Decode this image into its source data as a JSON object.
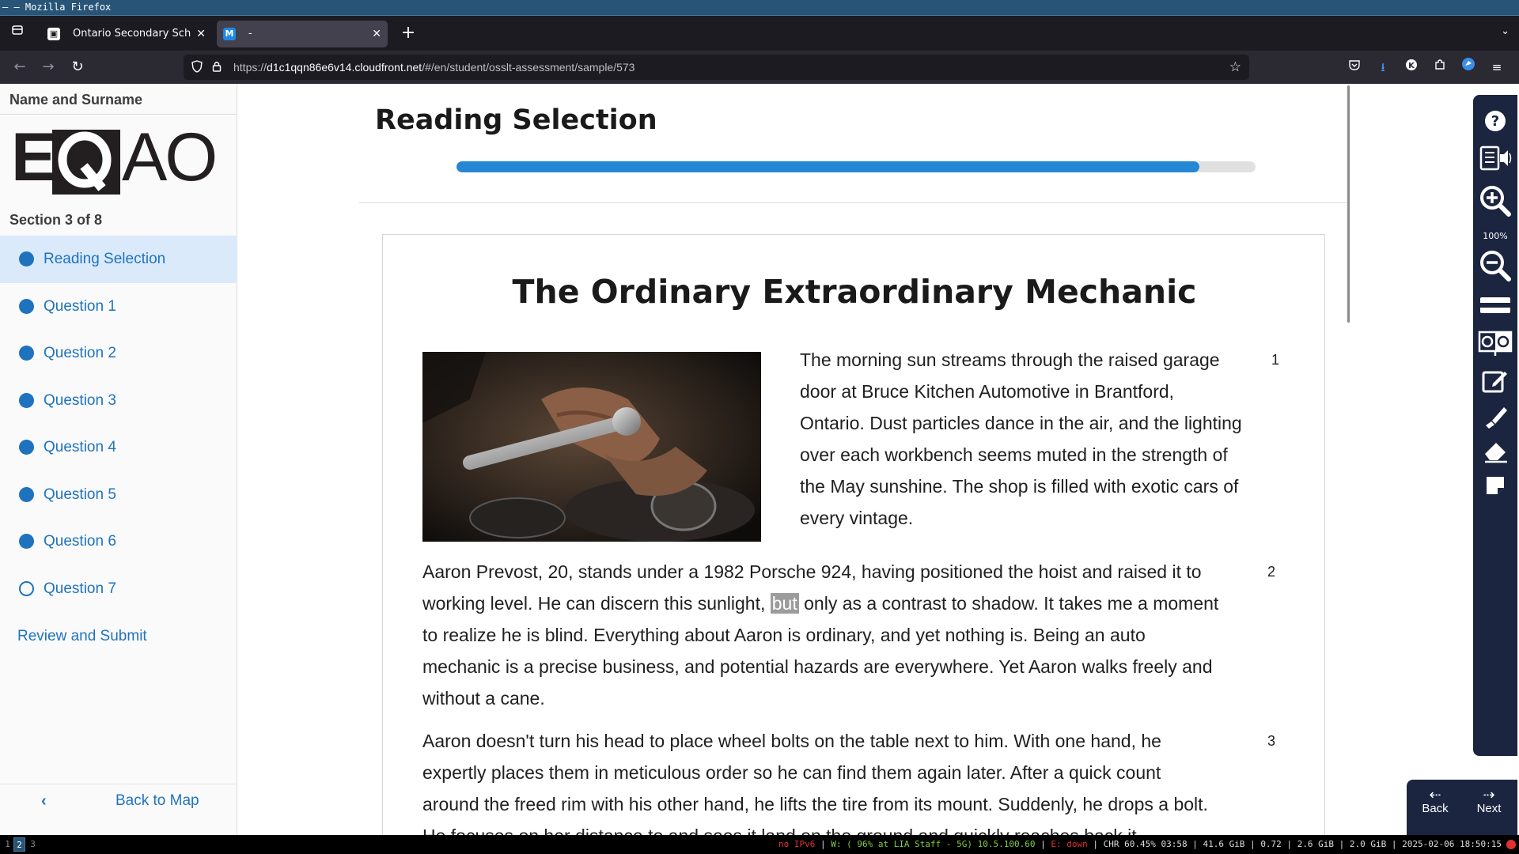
{
  "window": {
    "title": "– – Mozilla Firefox"
  },
  "browser": {
    "tabs": [
      {
        "title": "Ontario Secondary School",
        "favicon": "osslt-favicon"
      },
      {
        "title": "-",
        "favicon": "M"
      }
    ],
    "url_prefix": "https://",
    "url_host": "d1c1qqn86e6v14.cloudfront.net",
    "url_path": "/#/en/student/osslt-assessment/sample/573"
  },
  "sidebar": {
    "student_name": "Name and Surname",
    "logo_text": "EQAO",
    "section_label": "Section 3 of 8",
    "items": [
      {
        "label": "Reading Selection",
        "active": true,
        "completed": true
      },
      {
        "label": "Question 1",
        "completed": true
      },
      {
        "label": "Question 2",
        "completed": true
      },
      {
        "label": "Question 3",
        "completed": true
      },
      {
        "label": "Question 4",
        "completed": true
      },
      {
        "label": "Question 5",
        "completed": true
      },
      {
        "label": "Question 6",
        "completed": true
      },
      {
        "label": "Question 7",
        "completed": false
      }
    ],
    "review_label": "Review and Submit",
    "back_label": "Back to Map"
  },
  "main": {
    "heading": "Reading Selection",
    "progress_fraction": 0.93,
    "article": {
      "title": "The Ordinary Extraordinary Mechanic",
      "paragraphs": [
        {
          "number": "1",
          "text": "The morning sun streams through the raised garage door at Bruce Kitchen Automotive in Brantford, Ontario. Dust particles dance in the air, and the lighting over each workbench seems muted in the strength of the May sunshine. The shop is filled with exotic cars of every vintage."
        },
        {
          "number": "2",
          "text_before": "Aaron Prevost, 20, stands under a 1982 Porsche 924, having positioned the hoist and raised it to working level. He can discern this sunlight,",
          "highlighted": "but",
          "text_after": "only as a contrast to shadow. It takes me a moment to realize he is blind. Everything about Aaron is ordinary, and yet nothing is. Being an auto mechanic is a precise business, and potential hazards are everywhere. Yet Aaron walks freely and without a cane."
        },
        {
          "number": "3",
          "text": "Aaron doesn't turn his head to place wheel bolts on the table next to him. With one hand, he expertly places them in meticulous order so he can find them again later. After a quick count around the freed rim with his other hand, he lifts the tire from its mount. Suddenly, he drops a bolt. He focuses on her distance to and sees it land on the ground and quickly reaches back it"
        }
      ]
    }
  },
  "tools": {
    "zoom_level": "100%",
    "icons": [
      "help-icon",
      "text-to-speech-icon",
      "zoom-in-icon",
      "zoom-out-icon",
      "line-reader-icon",
      "contrast-icon",
      "notepad-icon",
      "highlighter-icon",
      "eraser-icon",
      "sticky-note-icon"
    ]
  },
  "footer_nav": {
    "back_label": "Back",
    "next_label": "Next"
  },
  "statusbar": {
    "workspaces": [
      "1",
      "2",
      "3"
    ],
    "active_workspace": "2",
    "ipv6": "no IPv6",
    "wifi": "W: ( 96% at LIA Staff - 5G) 10.5.100.60",
    "ethernet": "E: down",
    "battery": "CHR 60.45% 03:58",
    "disk": "41.6 GiB",
    "load": "0.72",
    "mem": "2.6 GiB",
    "swap": "2.0 GiB",
    "datetime": "2025-02-06 18:50:15"
  },
  "colors": {
    "accent": "#1f73be",
    "progress": "#2587d3",
    "tool_panel": "#1b2540",
    "active_item_bg": "#dbeafb"
  }
}
